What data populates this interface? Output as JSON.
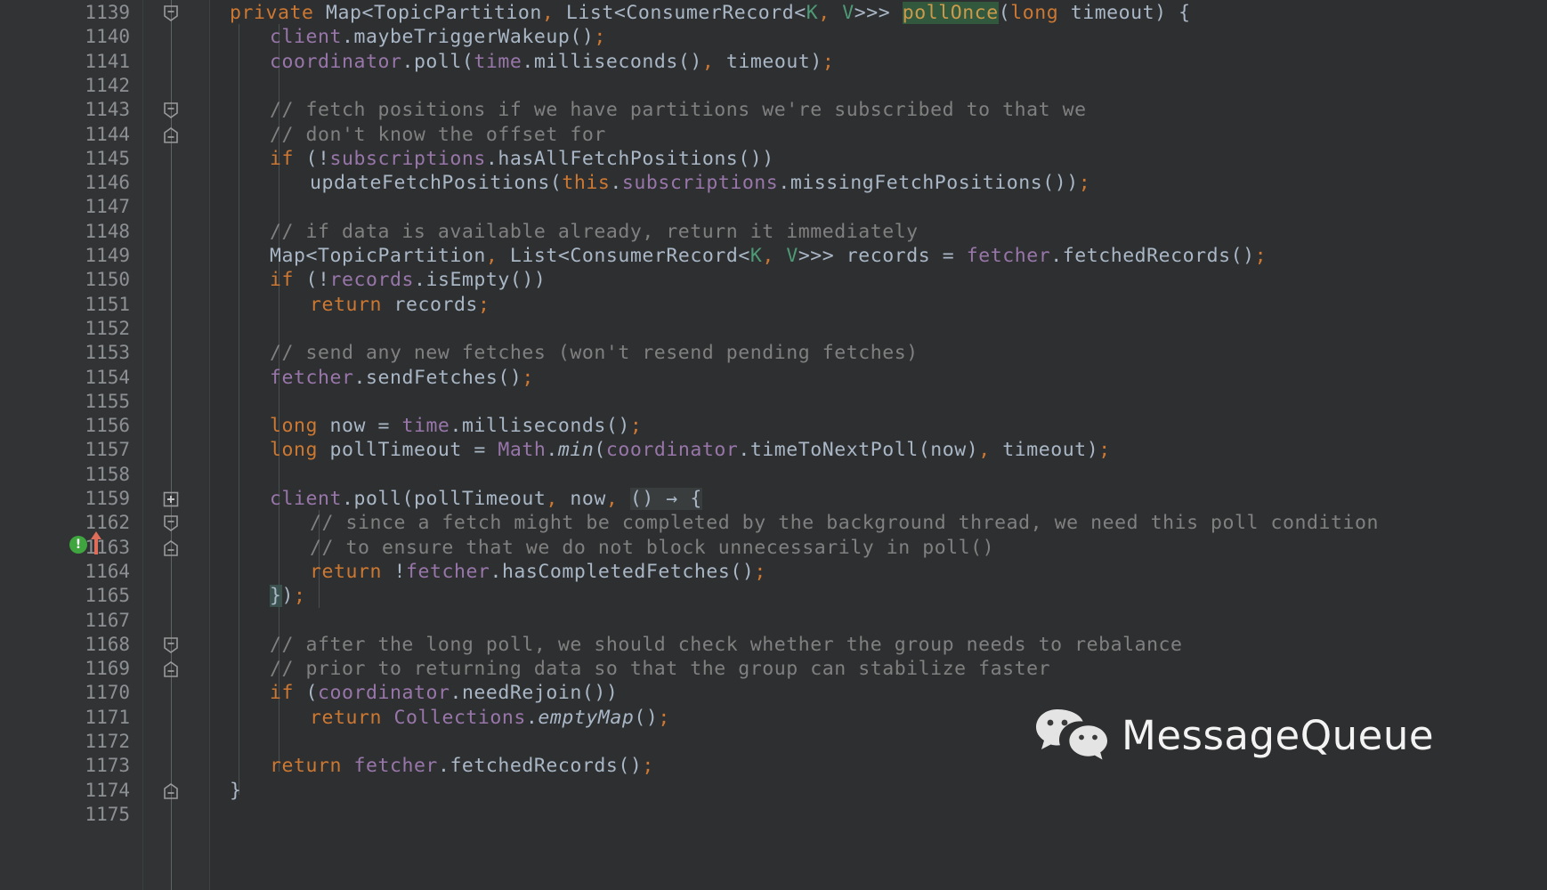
{
  "editor": {
    "theme": "darcula",
    "background": "#2e2f30",
    "gutter_background": "#313335",
    "line_number_color": "#8d9093",
    "default_text_color": "#a9b7c6",
    "keyword_color": "#cc7832",
    "field_color": "#9876aa",
    "comment_color": "#808080",
    "type_param_color": "#4e9a77",
    "search_highlight_bg": "#32593d",
    "search_highlight_fg": "#cc9a4a",
    "brace_match_bg": "#3b514d",
    "language": "Java"
  },
  "lines": [
    {
      "num": "1139",
      "indent": 1,
      "fold": "start",
      "text": "private Map<TopicPartition, List<ConsumerRecord<K, V>>> pollOnce(long timeout) {"
    },
    {
      "num": "1140",
      "indent": 2,
      "fold": "",
      "text": "client.maybeTriggerWakeup();"
    },
    {
      "num": "1141",
      "indent": 2,
      "fold": "",
      "text": "coordinator.poll(time.milliseconds(), timeout);"
    },
    {
      "num": "1142",
      "indent": 0,
      "fold": "",
      "text": ""
    },
    {
      "num": "1143",
      "indent": 2,
      "fold": "start",
      "text": "// fetch positions if we have partitions we're subscribed to that we"
    },
    {
      "num": "1144",
      "indent": 2,
      "fold": "end",
      "text": "// don't know the offset for"
    },
    {
      "num": "1145",
      "indent": 2,
      "fold": "",
      "text": "if (!subscriptions.hasAllFetchPositions())"
    },
    {
      "num": "1146",
      "indent": 3,
      "fold": "",
      "text": "updateFetchPositions(this.subscriptions.missingFetchPositions());"
    },
    {
      "num": "1147",
      "indent": 0,
      "fold": "",
      "text": ""
    },
    {
      "num": "1148",
      "indent": 2,
      "fold": "",
      "text": "// if data is available already, return it immediately"
    },
    {
      "num": "1149",
      "indent": 2,
      "fold": "",
      "text": "Map<TopicPartition, List<ConsumerRecord<K, V>>> records = fetcher.fetchedRecords();"
    },
    {
      "num": "1150",
      "indent": 2,
      "fold": "",
      "text": "if (!records.isEmpty())"
    },
    {
      "num": "1151",
      "indent": 3,
      "fold": "",
      "text": "return records;"
    },
    {
      "num": "1152",
      "indent": 0,
      "fold": "",
      "text": ""
    },
    {
      "num": "1153",
      "indent": 2,
      "fold": "",
      "text": "// send any new fetches (won't resend pending fetches)"
    },
    {
      "num": "1154",
      "indent": 2,
      "fold": "",
      "text": "fetcher.sendFetches();"
    },
    {
      "num": "1155",
      "indent": 0,
      "fold": "",
      "text": ""
    },
    {
      "num": "1156",
      "indent": 2,
      "fold": "",
      "text": "long now = time.milliseconds();"
    },
    {
      "num": "1157",
      "indent": 2,
      "fold": "",
      "text": "long pollTimeout = Math.min(coordinator.timeToNextPoll(now), timeout);"
    },
    {
      "num": "1158",
      "indent": 0,
      "fold": "",
      "text": ""
    },
    {
      "num": "1159",
      "indent": 2,
      "fold": "expand",
      "text": "client.poll(pollTimeout, now, () -> {"
    },
    {
      "num": "1162",
      "indent": 3,
      "fold": "start",
      "text": "// since a fetch might be completed by the background thread, we need this poll condition"
    },
    {
      "num": "1163",
      "indent": 3,
      "fold": "end",
      "text": "// to ensure that we do not block unnecessarily in poll()"
    },
    {
      "num": "1164",
      "indent": 3,
      "fold": "",
      "text": "return !fetcher.hasCompletedFetches();"
    },
    {
      "num": "1165",
      "indent": 2,
      "fold": "",
      "text": "});"
    },
    {
      "num": "1167",
      "indent": 0,
      "fold": "",
      "text": ""
    },
    {
      "num": "1168",
      "indent": 2,
      "fold": "start",
      "text": "// after the long poll, we should check whether the group needs to rebalance"
    },
    {
      "num": "1169",
      "indent": 2,
      "fold": "end",
      "text": "// prior to returning data so that the group can stabilize faster"
    },
    {
      "num": "1170",
      "indent": 2,
      "fold": "",
      "text": "if (coordinator.needRejoin())"
    },
    {
      "num": "1171",
      "indent": 3,
      "fold": "",
      "text": "return Collections.emptyMap();"
    },
    {
      "num": "1172",
      "indent": 0,
      "fold": "",
      "text": ""
    },
    {
      "num": "1173",
      "indent": 2,
      "fold": "",
      "text": "return fetcher.fetchedRecords();"
    },
    {
      "num": "1174",
      "indent": 1,
      "fold": "end",
      "text": "}"
    },
    {
      "num": "1175",
      "indent": 0,
      "fold": "",
      "text": ""
    }
  ],
  "gutter_annotations": {
    "line": "1159",
    "bulb_icon": "info-bulb-icon",
    "bulb_glyph": "!",
    "bulb_color": "#3fa63f",
    "arrow_icon": "method-override-up-arrow-icon",
    "arrow_color": "#e06c5a"
  },
  "highlights": {
    "search_term": "pollOnce",
    "matched_brace": "}",
    "lambda_token": "() → {"
  },
  "watermark": {
    "logo_icon": "wechat-logo-icon",
    "text": "MessageQueue"
  }
}
